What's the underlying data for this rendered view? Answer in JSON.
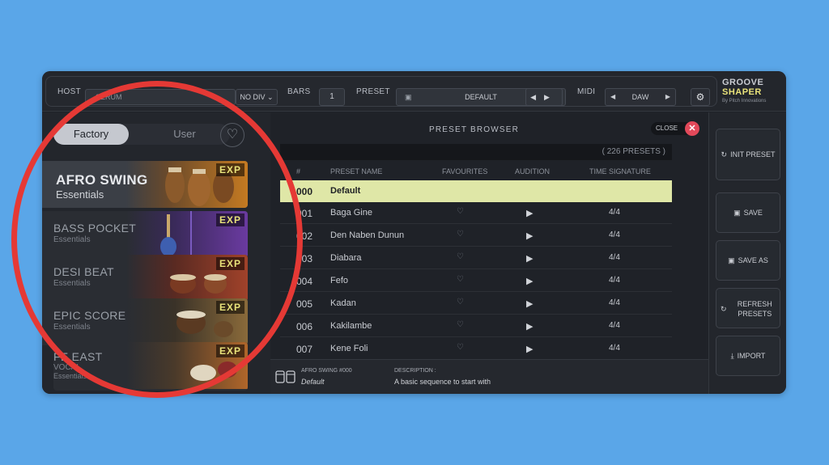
{
  "topbar": {
    "host_label": "HOST",
    "host_value": "SERUM",
    "nodiv_value": "NO DIV",
    "bars_label": "BARS",
    "bars_value": "1",
    "preset_label": "PRESET",
    "preset_value": "DEFAULT",
    "midi_label": "MIDI",
    "midi_value": "DAW",
    "logo_line1": "GROOVE",
    "logo_line2": "SHAPER",
    "logo_by": "By Pitch Innovations"
  },
  "sidebar": {
    "tabs": [
      "Factory",
      "User"
    ],
    "packs": [
      {
        "title": "AFRO SWING",
        "subtitle": "Essentials",
        "badge": "EXP"
      },
      {
        "title": "BASS POCKET",
        "subtitle": "Essentials",
        "badge": "EXP"
      },
      {
        "title": "DESI BEAT",
        "subtitle": "Essentials",
        "badge": "EXP"
      },
      {
        "title": "EPIC SCORE",
        "subtitle": "Essentials",
        "badge": "EXP"
      },
      {
        "title": "FE EAST",
        "subtitle": "VOCAL",
        "subtitle2": "Essentials",
        "badge": "EXP"
      }
    ]
  },
  "browser": {
    "title": "PRESET BROWSER",
    "close_label": "CLOSE",
    "count": "( 226 PRESETS )",
    "headers": {
      "num": "#",
      "name": "PRESET NAME",
      "fav": "FAVOURITES",
      "audition": "AUDITION",
      "ts": "TIME SIGNATURE"
    },
    "rows": [
      {
        "num": "000",
        "name": "Default",
        "ts": ""
      },
      {
        "num": "001",
        "name": "Baga Gine",
        "ts": "4/4"
      },
      {
        "num": "002",
        "name": "Den Naben Dunun",
        "ts": "4/4"
      },
      {
        "num": "003",
        "name": "Diabara",
        "ts": "4/4"
      },
      {
        "num": "004",
        "name": "Fefo",
        "ts": "4/4"
      },
      {
        "num": "005",
        "name": "Kadan",
        "ts": "4/4"
      },
      {
        "num": "006",
        "name": "Kakilambe",
        "ts": "4/4"
      },
      {
        "num": "007",
        "name": "Kene Foli",
        "ts": "4/4"
      }
    ],
    "footer": {
      "pack_id": "AFRO SWING #000",
      "preset_name": "Default",
      "desc_label": "DESCRIPTION :",
      "description": "A basic sequence to start with"
    }
  },
  "actions": {
    "init": "INIT PRESET",
    "save": "SAVE",
    "save_as": "SAVE AS",
    "refresh_1": "REFRESH",
    "refresh_2": "PRESETS",
    "import": "IMPORT"
  },
  "colors": {
    "background": "#5aa6e8",
    "selected_row": "#dfe7a7",
    "accent_yellow": "#e8e27a",
    "close_red": "#e2495a",
    "highlight_circle": "#e53935"
  }
}
